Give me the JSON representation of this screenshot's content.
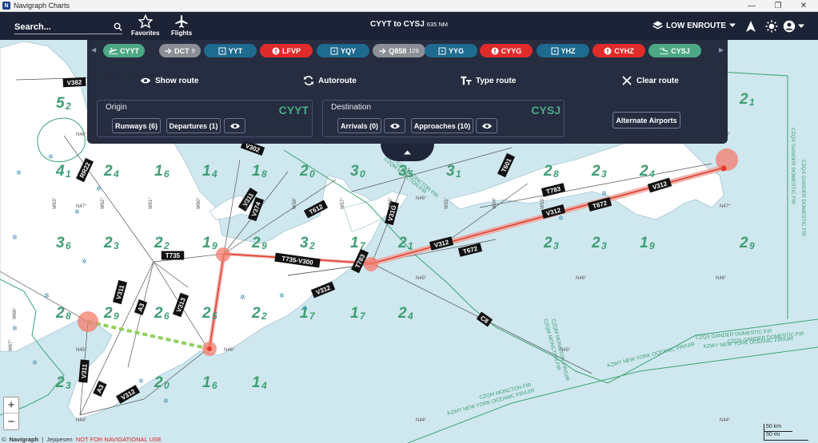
{
  "window": {
    "title": "Navigraph Charts",
    "icon_letter": "N"
  },
  "topbar": {
    "search_label": "Search...",
    "favorites_label": "Favorites",
    "flights_label": "Flights",
    "route_title": "CYYT to CYSJ",
    "route_distance": "635 NM",
    "layer_label": "LOW ENROUTE"
  },
  "route_chips": [
    {
      "label": "CYYT",
      "icon": "departure-icon",
      "count": "",
      "color": "#4da886"
    },
    {
      "label": "DCT",
      "icon": "arrow-right-icon",
      "count": "9",
      "color": "#8d8f96"
    },
    {
      "label": "YYT",
      "icon": "navaid-icon",
      "count": "",
      "color": "#1f6a8f"
    },
    {
      "label": "LFVP",
      "icon": "alert-icon",
      "count": "",
      "color": "#e02b2b"
    },
    {
      "label": "YQY",
      "icon": "navaid-icon",
      "count": "",
      "color": "#1f6a8f"
    },
    {
      "label": "Q858",
      "icon": "arrow-right-icon",
      "count": "128",
      "color": "#8d8f96"
    },
    {
      "label": "YYG",
      "icon": "navaid-icon",
      "count": "",
      "color": "#1f6a8f"
    },
    {
      "label": "CYYG",
      "icon": "alert-icon",
      "count": "",
      "color": "#e02b2b"
    },
    {
      "label": "YHZ",
      "icon": "navaid-icon",
      "count": "",
      "color": "#1f6a8f"
    },
    {
      "label": "CYHZ",
      "icon": "alert-icon",
      "count": "",
      "color": "#e02b2b"
    },
    {
      "label": "CYSJ",
      "icon": "arrival-icon",
      "count": "",
      "color": "#4da886"
    }
  ],
  "actions": {
    "show_route": "Show route",
    "autoroute": "Autoroute",
    "type_route": "Type route",
    "clear_route": "Clear route"
  },
  "origin": {
    "label": "Origin",
    "code": "CYYT",
    "runways": "Runways (6)",
    "departures": "Departures (1)"
  },
  "destination": {
    "label": "Destination",
    "code": "CYSJ",
    "arrivals": "Arrivals (0)",
    "approaches": "Approaches (10)"
  },
  "alternate_label": "Alternate Airports",
  "map": {
    "airway_labels": [
      "V382",
      "RR22",
      "V311",
      "V374",
      "T612",
      "V31G",
      "T735",
      "T735-V300",
      "T783",
      "V312",
      "T672",
      "V312",
      "T672",
      "T783",
      "T601",
      "V312",
      "A3",
      "V313",
      "V311",
      "V311",
      "A3",
      "V312",
      "C8",
      "V302",
      "V312"
    ],
    "grid_numbers": [
      "5",
      "2",
      "4",
      "1",
      "2",
      "4",
      "1",
      "6",
      "1",
      "4",
      "1",
      "8",
      "2",
      "0",
      "3",
      "0",
      "3",
      "5",
      "3",
      "1",
      "2",
      "8",
      "2",
      "3",
      "2",
      "4",
      "2",
      "1",
      "3",
      "6",
      "2",
      "3",
      "2",
      "2",
      "1",
      "9",
      "2",
      "9",
      "3",
      "2",
      "1",
      "7",
      "2",
      "1",
      "2",
      "3",
      "2",
      "3",
      "1",
      "9",
      "2",
      "9",
      "2",
      "8",
      "2",
      "9",
      "2",
      "6",
      "2",
      "5",
      "2",
      "2",
      "1",
      "7",
      "1",
      "7",
      "2",
      "4",
      "2",
      "3",
      "2",
      "0",
      "1",
      "6",
      "1",
      "4"
    ],
    "fir_labels": [
      "CZQX GANDER DOMESTIC FIR",
      "CZQX GANDER DOMESTIC FIR",
      "KZWY NEW YORK OCEANIC FIR/UIR",
      "KZWY NEW YORK OCEANIC FIR/UIR",
      "KZWY NEW YORK OCEANIC FIR/UIR",
      "CZQM MONCTON FIR",
      "CZQM MONCTON FIR",
      "CZQM MONCTON FIR",
      "CZQX GANDER DOMESTIC FIR",
      "CZQM MONCTON FIR/UIR",
      "CZQX GANDER DOMESTIC FIR",
      "CZQM MONCTON FIR"
    ],
    "lat_labels": [
      "N48°",
      "N47°",
      "N46°",
      "N45°",
      "N44°",
      "N46°",
      "N45°",
      "N44°",
      "N48°",
      "N47°",
      "N46°",
      "N44°",
      "N46°",
      "N45°"
    ],
    "lon_labels": [
      "W63°",
      "W62°",
      "W61°",
      "W60°",
      "W59°",
      "W58°",
      "W57°",
      "W56°",
      "W55°",
      "W54°",
      "W53°",
      "W66°",
      "W67°"
    ]
  },
  "footer": {
    "brand": "Navigraph",
    "provider": "Jeppesen",
    "warning": "NOT FOR NAVIGATIONAL USE"
  },
  "scale": {
    "km": "50 km",
    "mi": "50 mi"
  },
  "zoom": {
    "in": "+",
    "out": "−"
  }
}
